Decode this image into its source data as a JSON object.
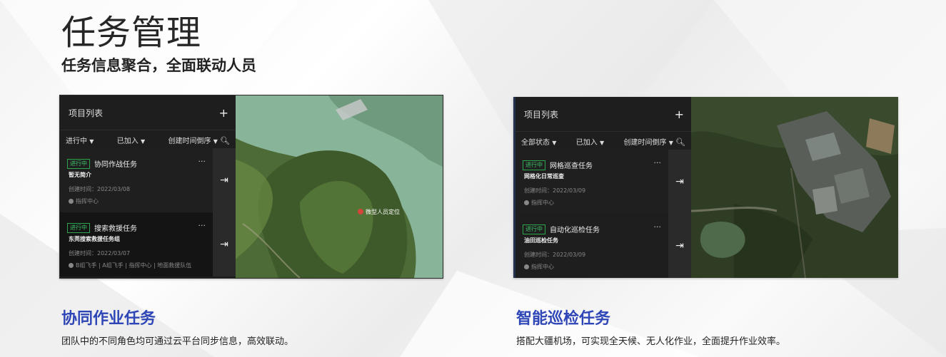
{
  "page": {
    "title": "任务管理",
    "subtitle": "任务信息聚合，全面联动人员"
  },
  "screenshots": [
    {
      "panel_title": "项目列表",
      "filters": {
        "status": "进行中",
        "joined": "已加入",
        "sort": "创建时间倒序"
      },
      "tasks": [
        {
          "badge": "进行中",
          "name": "协同作战任务",
          "desc": "暂无简介",
          "created": "创建时间：2022/03/08",
          "members": "指挥中心"
        },
        {
          "badge": "进行中",
          "name": "搜索救援任务",
          "desc": "东莞搜索救援任务组",
          "created": "创建时间：2022/03/07",
          "members": "B组飞手 | A组飞手 | 指挥中心 | 地面救援队伍"
        }
      ],
      "map_label": "微型人员定位"
    },
    {
      "panel_title": "项目列表",
      "filters": {
        "status": "全部状态",
        "joined": "已加入",
        "sort": "创建时间倒序"
      },
      "tasks": [
        {
          "badge": "进行中",
          "name": "网格巡查任务",
          "desc": "网格化日常巡查",
          "created": "创建时间：2022/03/09",
          "members": "指挥中心"
        },
        {
          "badge": "进行中",
          "name": "自动化巡检任务",
          "desc": "油田巡检任务",
          "created": "创建时间：2022/03/09",
          "members": "指挥中心"
        }
      ]
    }
  ],
  "features": [
    {
      "title": "协同作业任务",
      "desc": "团队中的不同角色均可通过云平台同步信息，高效联动。"
    },
    {
      "title": "智能巡检任务",
      "desc": "搭配大疆机场，可实现全天候、无人化作业，全面提升作业效率。"
    }
  ],
  "colors": {
    "accent": "#2f46b6",
    "badge": "#3ec46a",
    "panel_bg": "#1e1e1e"
  },
  "icons": {
    "add": "plus-icon",
    "search": "search-icon",
    "enter": "enter-icon",
    "more": "more-icon",
    "person": "person-icon",
    "caret": "caret-down-icon"
  }
}
